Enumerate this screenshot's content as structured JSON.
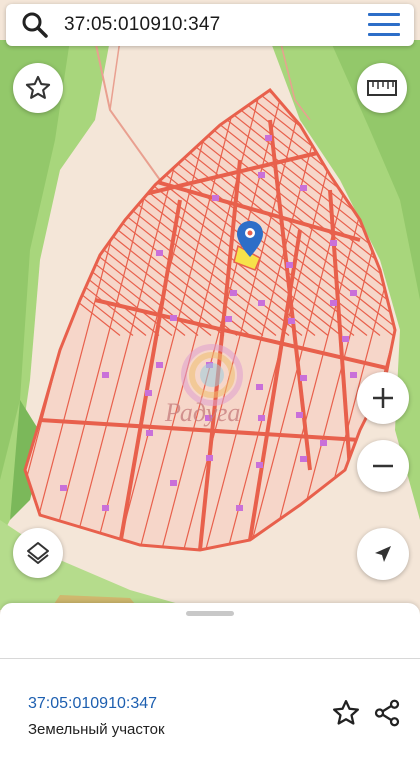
{
  "search": {
    "query": "37:05:010910:347"
  },
  "icons": {
    "search": "search-icon",
    "menu": "menu-icon",
    "favorite": "star-icon",
    "ruler": "ruler-icon",
    "zoom_in": "plus-icon",
    "zoom_out": "minus-icon",
    "layers": "layers-icon",
    "locate": "navigation-arrow-icon",
    "marker": "map-pin-icon",
    "share": "share-icon"
  },
  "map": {
    "watermark_text": "Радуга"
  },
  "sheet": {
    "cadastral_number": "37:05:010910:347",
    "parcel_type": "Земельный участок"
  },
  "colors": {
    "accent": "#2d6ec8",
    "link": "#1d5fb0",
    "parcel_border": "#e8604c",
    "parcel_fill": "#f6d6c9",
    "forest": "#a6d67a",
    "selected": "#f7e24a",
    "building": "#c970d9"
  }
}
